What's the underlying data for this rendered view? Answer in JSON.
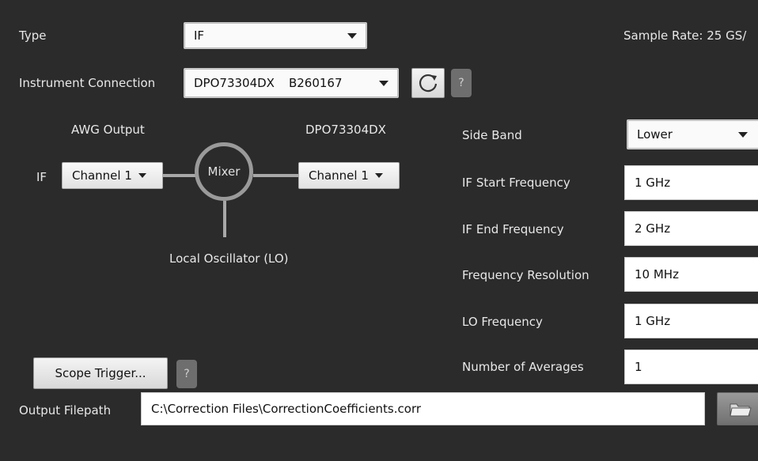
{
  "type": {
    "label": "Type",
    "value": "IF"
  },
  "sample_rate": "Sample Rate: 25 GS/",
  "instrument": {
    "label": "Instrument Connection",
    "model": "DPO73304DX",
    "serial": "B260167"
  },
  "diagram": {
    "awg_output": "AWG Output",
    "scope_model": "DPO73304DX",
    "if_label": "IF",
    "awg_channel": "Channel 1",
    "mixer": "Mixer",
    "scope_channel": "Channel 1",
    "lo_label": "Local Oscillator (LO)"
  },
  "settings": {
    "side_band": {
      "label": "Side Band",
      "value": "Lower"
    },
    "if_start": {
      "label": "IF Start Frequency",
      "value": "1 GHz"
    },
    "if_end": {
      "label": "IF End Frequency",
      "value": "2 GHz"
    },
    "freq_res": {
      "label": "Frequency Resolution",
      "value": "10 MHz"
    },
    "lo_freq": {
      "label": "LO Frequency",
      "value": "1 GHz"
    },
    "averages": {
      "label": "Number of Averages",
      "value": "1"
    }
  },
  "scope_trigger": {
    "label": "Scope Trigger..."
  },
  "help_glyph": "?",
  "output": {
    "label": "Output Filepath",
    "path": "C:\\Correction Files\\CorrectionCoefficients.corr"
  }
}
